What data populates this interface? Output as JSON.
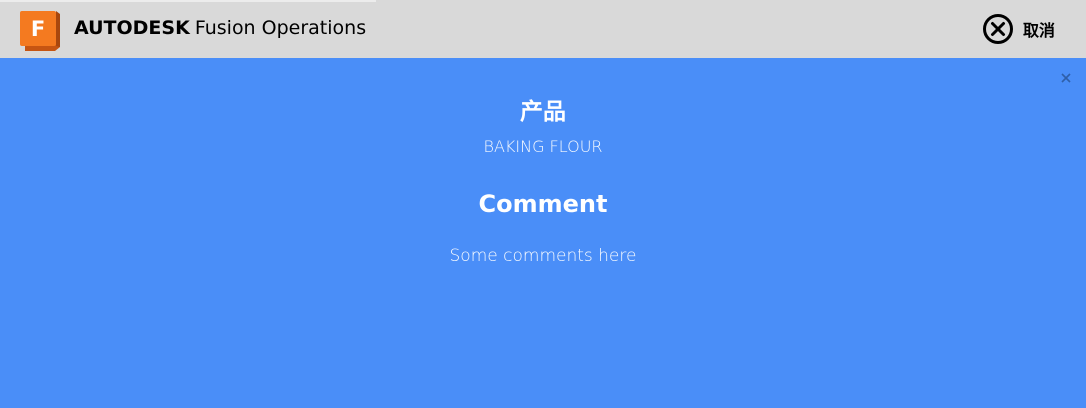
{
  "header": {
    "brand_primary": "AUTODESK",
    "brand_secondary": "Fusion Operations",
    "logo_letter": "F",
    "logo_icon": "fusion-logo-icon",
    "cancel_label": "取消",
    "cancel_icon": "circle-close-icon"
  },
  "main": {
    "close_icon": "close-icon",
    "product_heading": "产品",
    "product_value": "BAKING FLOUR",
    "comment_heading": "Comment",
    "comment_value": "Some comments here"
  },
  "colors": {
    "header_bg": "#d9d9d9",
    "main_bg": "#4a8ef8",
    "logo_orange": "#f47a20",
    "logo_dark": "#c65512",
    "text_light": "#ffffff",
    "text_dark": "#000000"
  }
}
